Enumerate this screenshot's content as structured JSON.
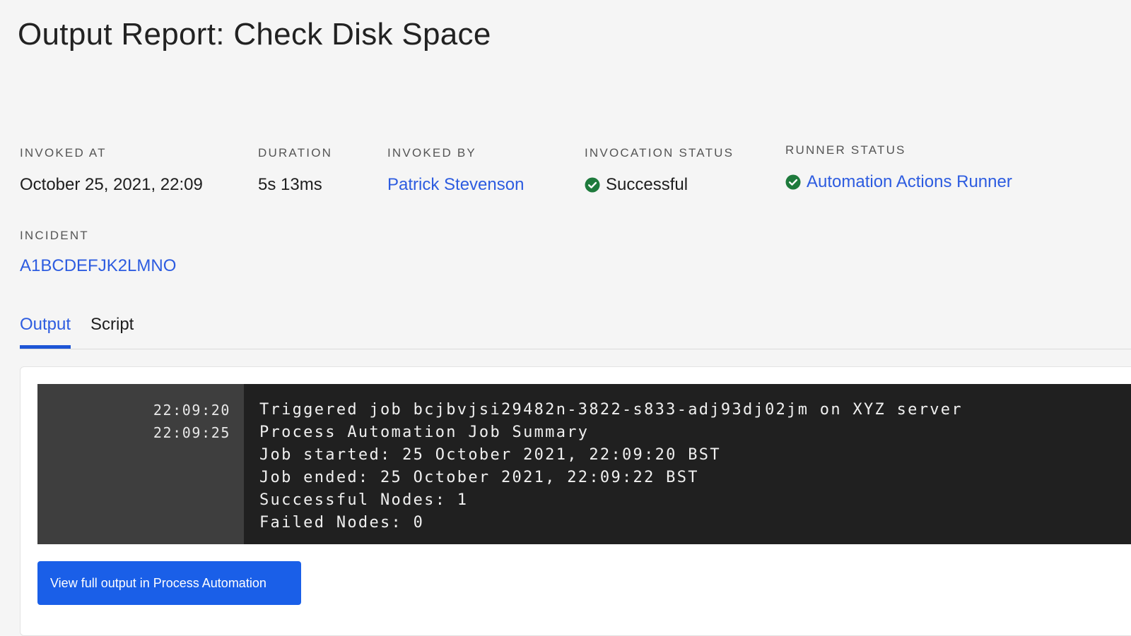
{
  "page": {
    "title": "Output Report: Check Disk Space"
  },
  "meta": {
    "invoked_at": {
      "label": "INVOKED AT",
      "value": "October 25, 2021, 22:09"
    },
    "duration": {
      "label": "DURATION",
      "value": "5s 13ms"
    },
    "invoked_by": {
      "label": "INVOKED BY",
      "value": "Patrick Stevenson"
    },
    "invocation_status": {
      "label": "INVOCATION STATUS",
      "value": "Successful",
      "icon": "check-circle-icon",
      "color": "#1e7a3c"
    },
    "runner_status": {
      "label": "RUNNER STATUS",
      "value": "Automation Actions Runner",
      "icon": "check-circle-icon",
      "color": "#1e7a3c"
    },
    "incident": {
      "label": "INCIDENT",
      "value": "A1BCDEFJK2LMNO"
    }
  },
  "tabs": [
    {
      "label": "Output",
      "active": true
    },
    {
      "label": "Script",
      "active": false
    }
  ],
  "output": {
    "timestamps": [
      "22:09:20",
      "22:09:25"
    ],
    "lines": [
      "Triggered job bcjbvjsi29482n-3822-s833-adj93dj02jm on XYZ server",
      "Process Automation Job Summary",
      "Job started: 25 October 2021, 22:09:20 BST",
      "Job ended: 25 October 2021, 22:09:22 BST",
      "Successful Nodes: 1",
      "Failed Nodes: 0"
    ]
  },
  "actions": {
    "view_full_output_label": "View full output in Process Automation"
  },
  "colors": {
    "accent": "#2d5ce0",
    "button": "#1a5fe8",
    "success": "#1e7a3c",
    "terminal_bg": "#202020",
    "gutter_bg": "#3e3e3e"
  }
}
